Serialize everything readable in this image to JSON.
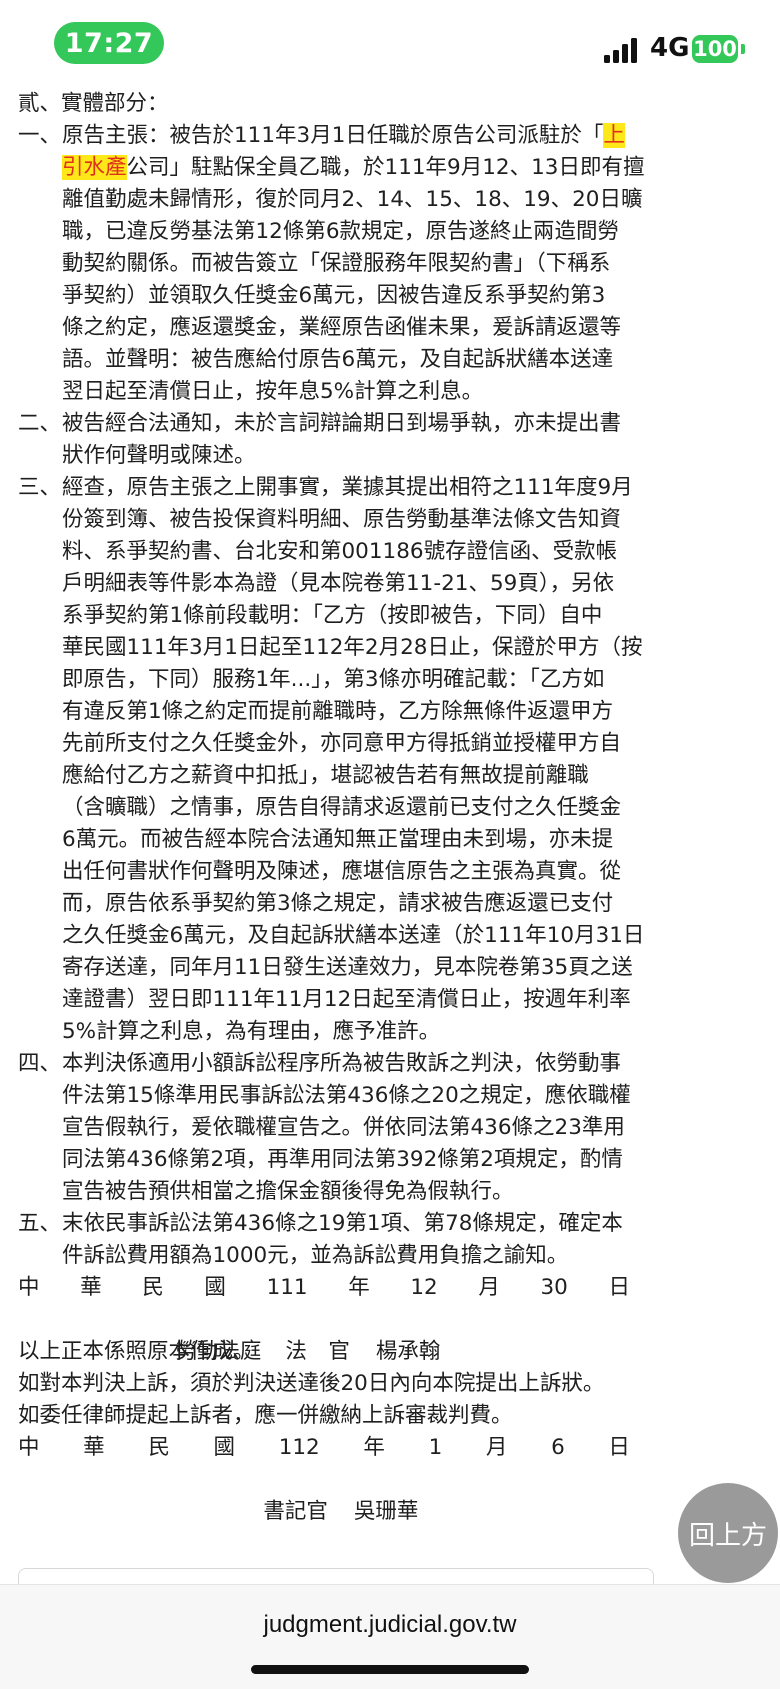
{
  "status": {
    "time": "17:27",
    "network": "4G",
    "battery": "100"
  },
  "doc": {
    "heading": "貳、實體部分：",
    "items": [
      {
        "num": "一、",
        "lines": [
          "原告主張：被告於111年3月1日任職於原告公司派駐於「上",
          "引水產公司」駐點保全員乙職，於111年9月12、13日即有擅",
          "離值勤處未歸情形，復於同月2、14、15、18、19、20日曠",
          "職，已違反勞基法第12條第6款規定，原告遂終止兩造間勞",
          "動契約關係。而被告簽立「保證服務年限契約書」（下稱系",
          "爭契約）並領取久任獎金6萬元，因被告違反系爭契約第3",
          "條之約定，應返還獎金，業經原告函催未果，爰訴請返還等",
          "語。並聲明：被告應給付原告6萬元，及自起訴狀繕本送達",
          "翌日起至清償日止，按年息5%計算之利息。"
        ]
      },
      {
        "num": "二、",
        "lines": [
          "被告經合法通知，未於言詞辯論期日到場爭執，亦未提出書",
          "狀作何聲明或陳述。"
        ]
      },
      {
        "num": "三、",
        "lines": [
          "經查，原告主張之上開事實，業據其提出相符之111年度9月",
          "份簽到簿、被告投保資料明細、原告勞動基準法條文告知資",
          "料、系爭契約書、台北安和第001186號存證信函、受款帳",
          "戶明細表等件影本為證（見本院卷第11-21、59頁），另依",
          "系爭契約第1條前段載明：「乙方（按即被告，下同）自中",
          "華民國111年3月1日起至112年2月28日止，保證於甲方（按",
          "即原告，下同）服務1年...」，第3條亦明確記載：「乙方如",
          "有違反第1條之約定而提前離職時，乙方除無條件返還甲方",
          "先前所支付之久任獎金外，亦同意甲方得抵銷並授權甲方自",
          "應給付乙方之薪資中扣抵」，堪認被告若有無故提前離職",
          "（含曠職）之情事，原告自得請求返還前已支付之久任獎金",
          "6萬元。而被告經本院合法通知無正當理由未到場，亦未提",
          "出任何書狀作何聲明及陳述，應堪信原告之主張為真實。從",
          "而，原告依系爭契約第3條之規定，請求被告應返還已支付",
          "之久任獎金6萬元，及自起訴狀繕本送達（於111年10月31日",
          "寄存送達，同年月11日發生送達效力，見本院卷第35頁之送",
          "達證書）翌日即111年11月12日起至清償日止，按週年利率",
          "5%計算之利息，為有理由，應予准許。"
        ]
      },
      {
        "num": "四、",
        "lines": [
          "本判決係適用小額訴訟程序所為被告敗訴之判決，依勞動事",
          "件法第15條準用民事訴訟法第436條之20之規定，應依職權",
          "宣告假執行，爰依職權宣告之。併依同法第436條之23準用",
          "同法第436條第2項，再準用同法第392條第2項規定，酌情",
          "宣告被告預供相當之擔保金額後得免為假執行。"
        ]
      },
      {
        "num": "五、",
        "lines": [
          "末依民事訴訟法第436條之19第1項、第78條規定，確定本",
          "件訴訟費用額為1000元，並為訴訟費用負擔之諭知。"
        ]
      }
    ],
    "highlight": {
      "line1": "上",
      "line2": "引水產"
    },
    "date1": [
      "中",
      "華",
      "民",
      "國",
      "111",
      "年",
      "12",
      "月",
      "30",
      "日"
    ],
    "court": "勞動法庭",
    "judge_title": "法　官",
    "judge_name": "楊承翰",
    "certify": "以上正本係照原本作成。",
    "appeal_1": "如對本判決上訴，須於判決送達後20日內向本院提出上訴狀。",
    "appeal_2": "如委任律師提起上訴者，應一併繳納上訴審裁判費。",
    "date2": [
      "中",
      "華",
      "民",
      "國",
      "112",
      "年",
      "1",
      "月",
      "6",
      "日"
    ],
    "clerk_title": "書記官",
    "clerk_name": "吳珊華"
  },
  "partial_card_text": "⋯⋯⋯",
  "back_to_top": "回上方",
  "url": "judgment.judicial.gov.tw"
}
